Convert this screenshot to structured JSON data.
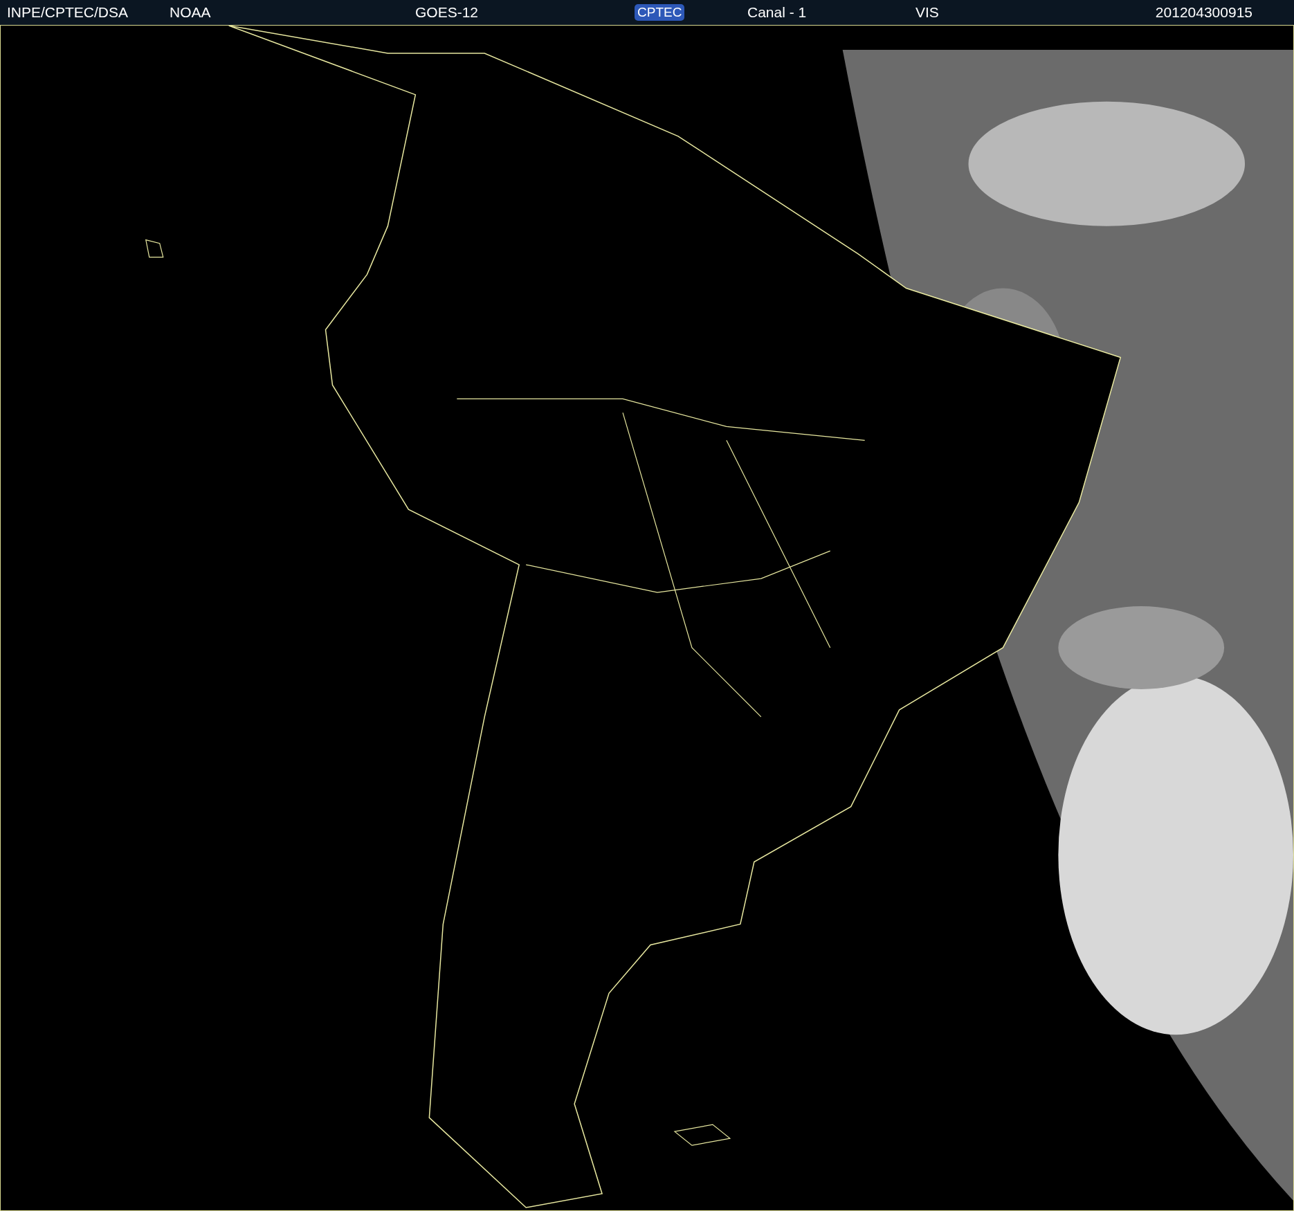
{
  "header": {
    "items": [
      {
        "kind": "text",
        "text": "INPE/CPTEC/DSA"
      },
      {
        "kind": "text",
        "text": "NOAA"
      },
      {
        "kind": "text",
        "text": "GOES-12"
      },
      {
        "kind": "logo",
        "text": "CPTEC"
      },
      {
        "kind": "text",
        "text": "Canal - 1"
      },
      {
        "kind": "text",
        "text": "VIS"
      },
      {
        "kind": "text",
        "text": "201204300915"
      }
    ]
  }
}
